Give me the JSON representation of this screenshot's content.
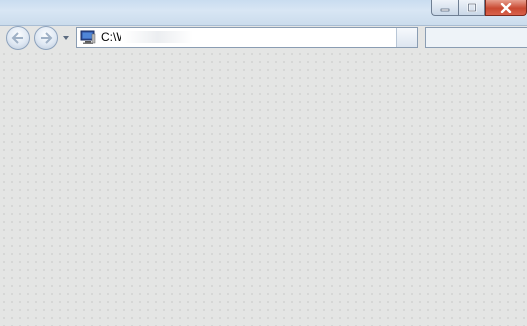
{
  "address_bar": {
    "path_text": "C:\\W"
  },
  "colors": {
    "titlebar": "#cadbec",
    "content_bg": "#e4e5e4",
    "close_button": "#c94a32"
  },
  "icons": {
    "back": "back-arrow-icon",
    "forward": "forward-arrow-icon",
    "recent": "chevron-down-icon",
    "address": "computer-icon",
    "minimize": "minimize-icon",
    "maximize": "maximize-icon",
    "close": "close-icon"
  }
}
